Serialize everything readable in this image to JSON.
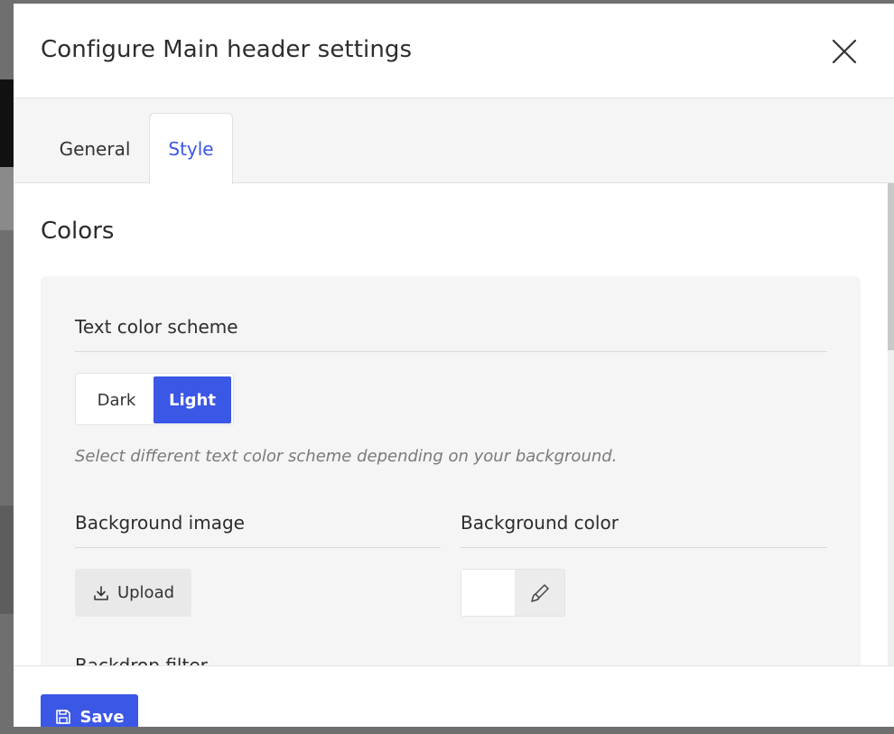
{
  "modal": {
    "title": "Configure Main header settings"
  },
  "tabs": [
    {
      "label": "General",
      "active": false
    },
    {
      "label": "Style",
      "active": true
    }
  ],
  "colors": {
    "section_title": "Colors",
    "text_color_scheme": {
      "label": "Text color scheme",
      "options": [
        "Dark",
        "Light"
      ],
      "selected": "Light",
      "hint": "Select different text color scheme depending on your background."
    },
    "background_image": {
      "label": "Background image",
      "upload_label": "Upload"
    },
    "background_color": {
      "label": "Background color",
      "value": "#ffffff"
    },
    "backdrop_filter": {
      "label": "Backdrop filter"
    }
  },
  "footer": {
    "save_label": "Save"
  },
  "theme": {
    "accent": "#3b57e6"
  }
}
